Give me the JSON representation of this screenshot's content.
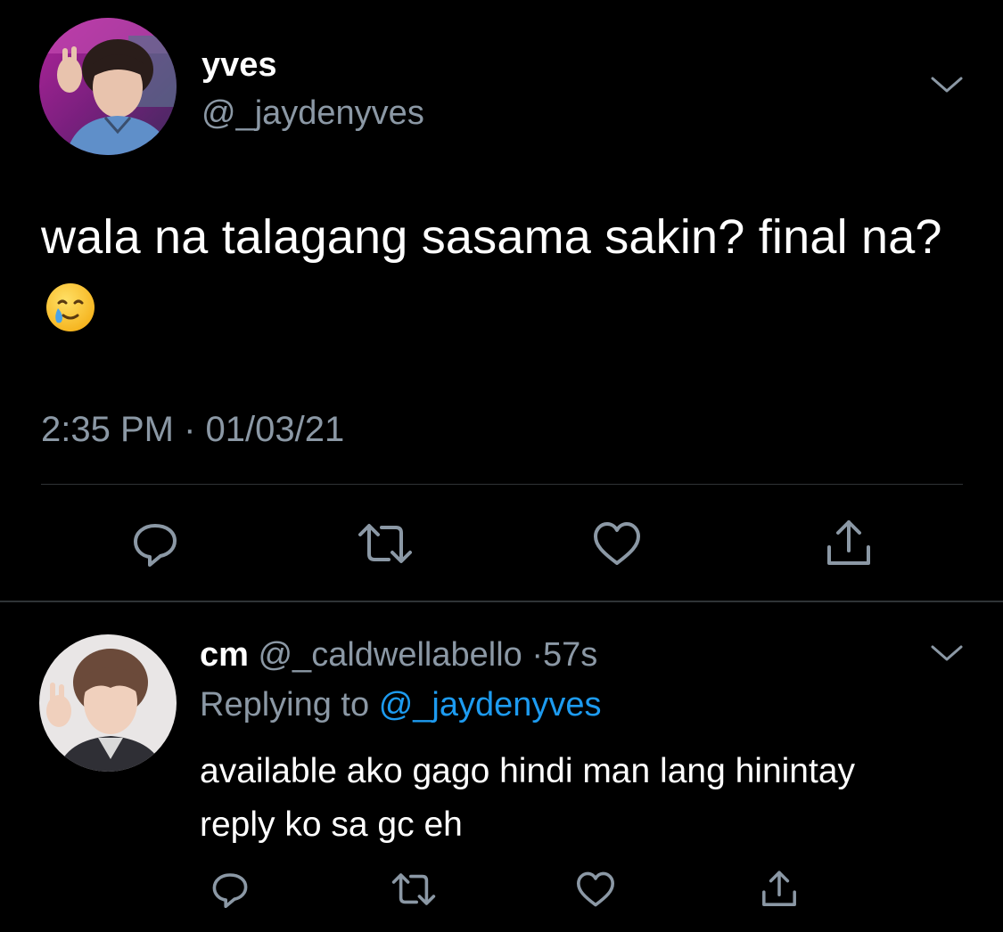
{
  "main_tweet": {
    "author_name": "yves",
    "author_handle": "@_jaydenyves",
    "text": "wala na talagang sasama sakin? final na?",
    "emoji": "smiling-face-with-tear-emoji",
    "timestamp": "2:35 PM · 01/03/21",
    "actions": [
      "reply-icon",
      "retweet-icon",
      "like-icon",
      "share-icon"
    ]
  },
  "reply_tweet": {
    "author_name": "cm",
    "author_handle": "@_caldwellabello",
    "separator": "·",
    "time_ago": "57s",
    "replying_prefix": "Replying to",
    "replying_handle": "@_jaydenyves",
    "text": "available ako gago hindi man lang hinintay reply ko sa gc eh",
    "actions": [
      "reply-icon",
      "retweet-icon",
      "like-icon",
      "share-icon"
    ]
  },
  "colors": {
    "background": "#000000",
    "primary_text": "#ffffff",
    "secondary_text": "#8b98a5",
    "link": "#1d9bf0",
    "divider": "#2f3336"
  }
}
